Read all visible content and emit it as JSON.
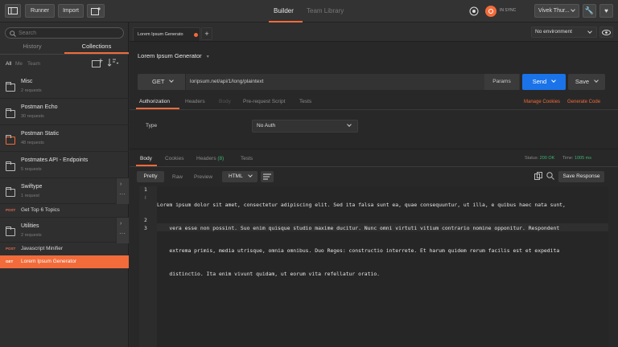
{
  "topbar": {
    "runner_label": "Runner",
    "import_label": "Import",
    "tabs": {
      "builder": "Builder",
      "team_library": "Team Library"
    },
    "sync_label": "IN SYNC",
    "user_name": "Vivek Thur...",
    "accent_color": "#f26b3a"
  },
  "sidebar": {
    "search_placeholder": "Search",
    "tabs": {
      "history": "History",
      "collections": "Collections"
    },
    "filters": {
      "all": "All",
      "me": "Me",
      "team": "Team"
    },
    "items": [
      {
        "type": "collection",
        "name": "Misc",
        "sub": "2 requests"
      },
      {
        "type": "collection",
        "name": "Postman Echo",
        "sub": "30 requests"
      },
      {
        "type": "collection",
        "name": "Postman Static",
        "sub": "48 requests"
      },
      {
        "type": "collection",
        "name": "Postmates API - Endpoints",
        "sub": "5 requests"
      },
      {
        "type": "collection",
        "name": "Swiftype",
        "sub": "1 request"
      },
      {
        "type": "request",
        "method": "POST",
        "name": "Get Top 6 Topics"
      },
      {
        "type": "collection",
        "name": "Utilities",
        "sub": "2 requests"
      },
      {
        "type": "request",
        "method": "POST",
        "name": "Javascript Minifier"
      },
      {
        "type": "request",
        "method": "GET",
        "name": "Lorem Ipsum Generator"
      }
    ]
  },
  "request_tab": {
    "label": "Lorem Ipsum Generato",
    "add": "+"
  },
  "environment": {
    "selected": "No environment"
  },
  "request": {
    "title": "Lorem Ipsum Generator",
    "method": "GET",
    "url": "loripsum.net/api/1/long/plaintext",
    "params_label": "Params",
    "send_label": "Send",
    "save_label": "Save",
    "tabs": [
      "Authorization",
      "Headers",
      "Body",
      "Pre-request Script",
      "Tests"
    ],
    "manage_cookies": "Manage Cookies",
    "generate_code": "Generate Code",
    "auth_type_label": "Type",
    "auth_type_value": "No Auth"
  },
  "response": {
    "tabs": {
      "body": "Body",
      "cookies": "Cookies",
      "headers": "Headers",
      "headers_count": "(8)",
      "tests": "Tests"
    },
    "status_label": "Status:",
    "status_value": "200 OK",
    "time_label": "Time:",
    "time_value": "1005 ms",
    "view_modes": [
      "Pretty",
      "Raw",
      "Preview"
    ],
    "format": "HTML",
    "save_response": "Save Response",
    "lines": [
      {
        "num": "1",
        "text": "Lorem ipsum dolor sit amet, consectetur adipiscing elit. Sed ita falsa sunt ea, quae consequuntur, ut illa, e quibus haec nata sunt,"
      },
      {
        "num": "",
        "text": "    vera esse non possint. Suo enim quisque studio maxime ducitur. Nunc omni virtuti vitium contrario nomine opponitur. Respondent"
      },
      {
        "num": "",
        "text": "    extrema primis, media utrisque, omnia omnibus. Duo Reges: constructio interrete. Et harum quidem rerum facilis est et expedita"
      },
      {
        "num": "",
        "text": "    distinctio. Ita enim vivunt quidam, ut eorum vita refellatur oratio."
      },
      {
        "num": "2",
        "text": ""
      },
      {
        "num": "3",
        "text": ""
      }
    ]
  }
}
